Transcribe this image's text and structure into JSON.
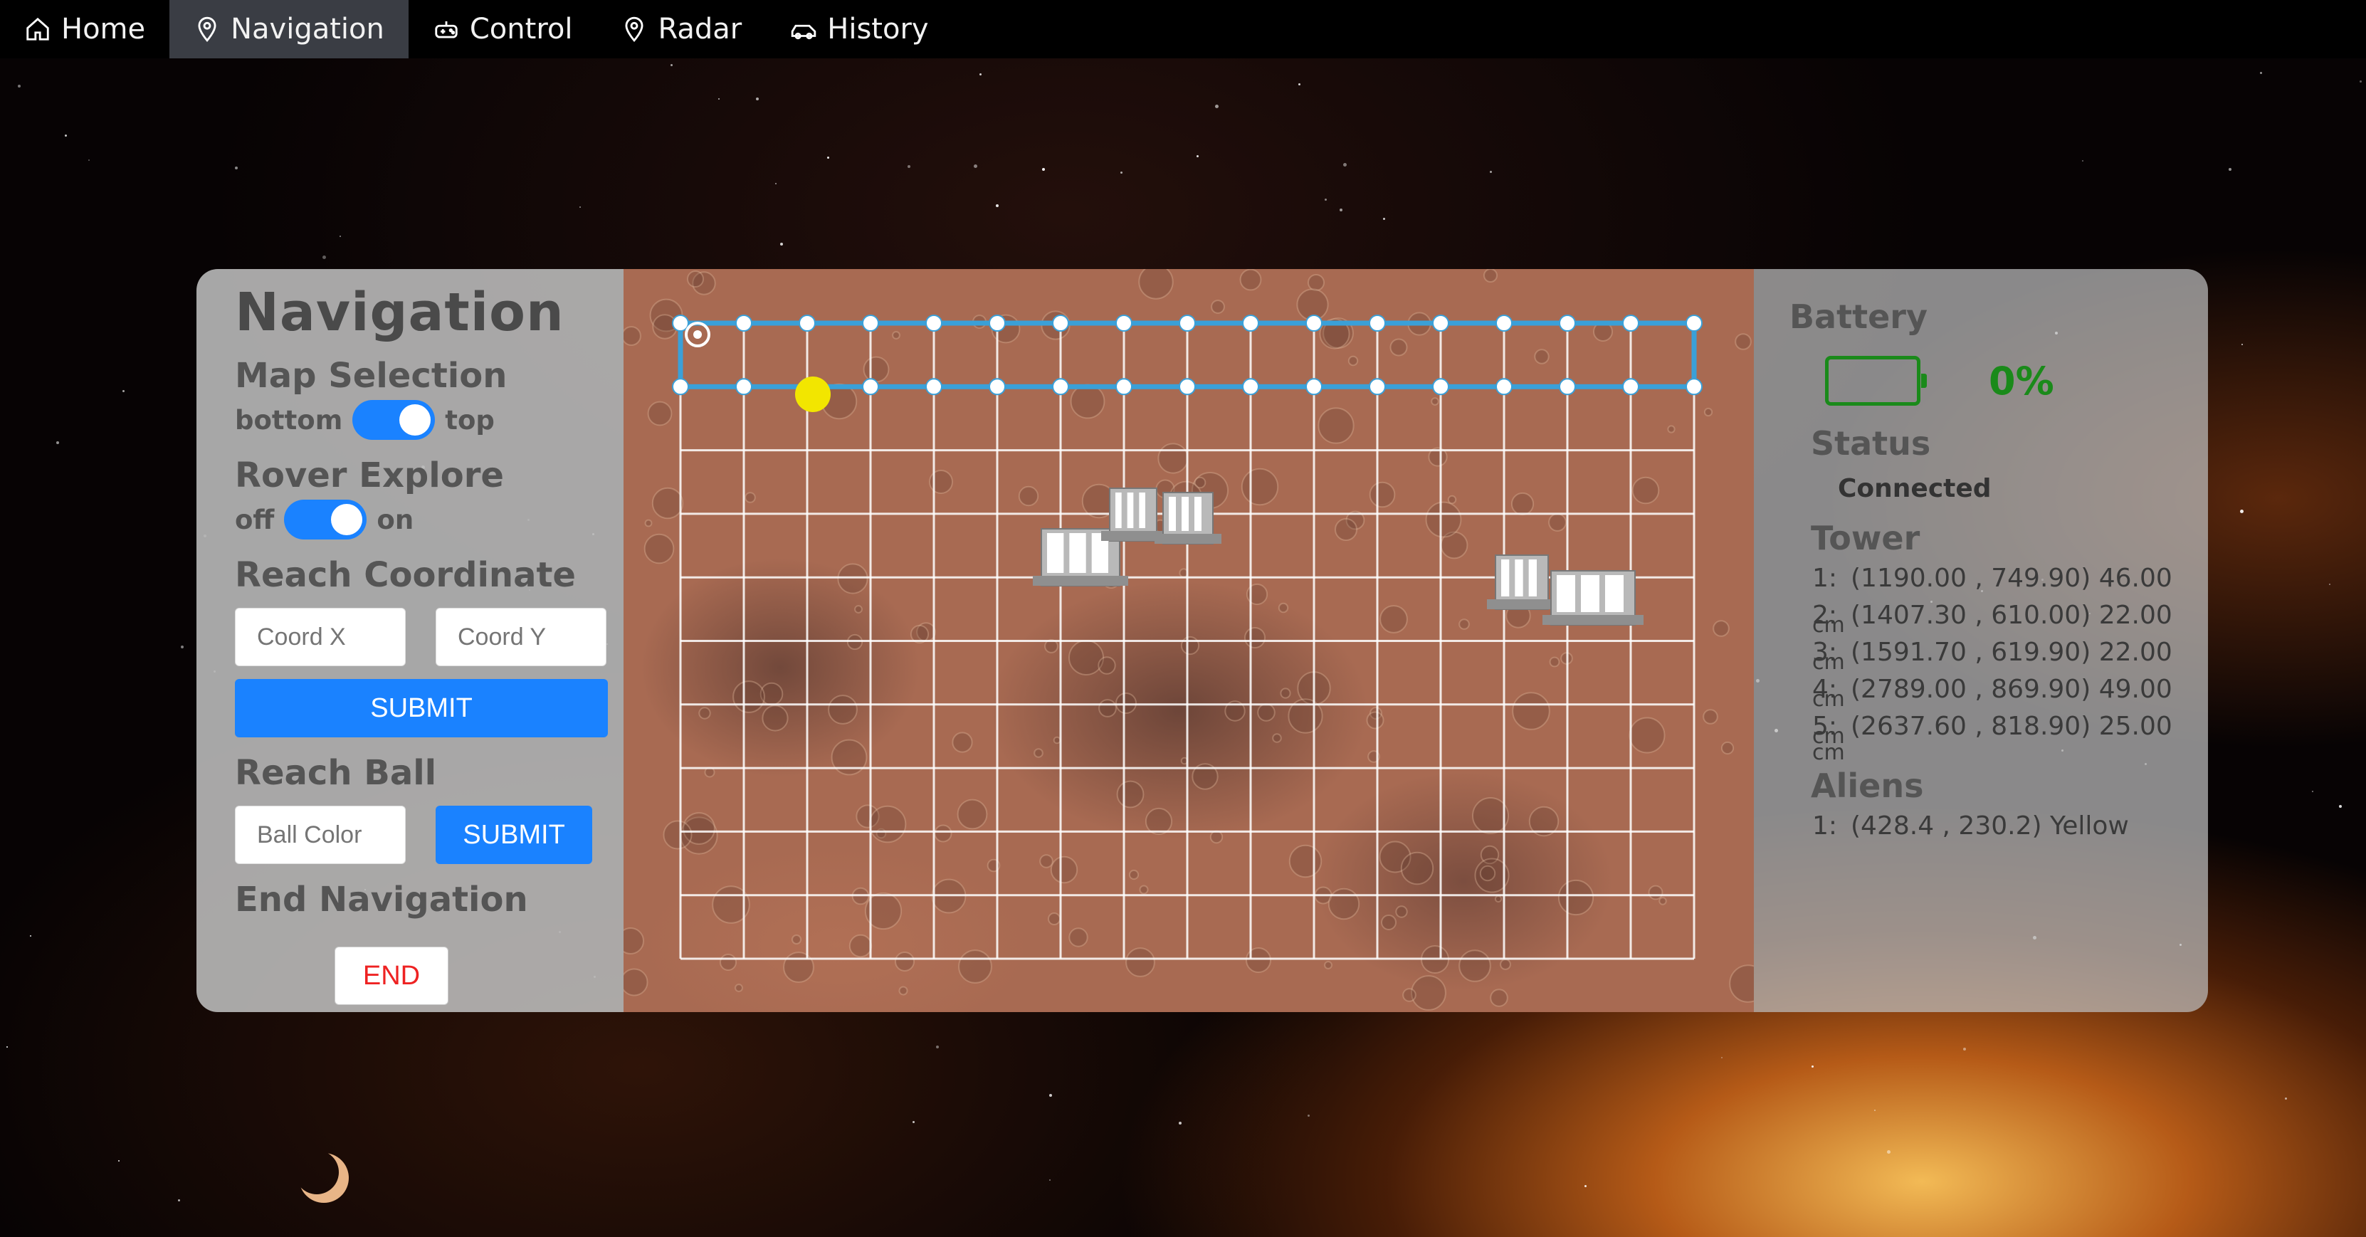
{
  "nav": {
    "items": [
      {
        "label": "Home",
        "icon": "home-icon"
      },
      {
        "label": "Navigation",
        "icon": "location-pin-icon"
      },
      {
        "label": "Control",
        "icon": "controller-icon"
      },
      {
        "label": "Radar",
        "icon": "location-pin-icon"
      },
      {
        "label": "History",
        "icon": "car-icon"
      }
    ],
    "active": "Navigation"
  },
  "left": {
    "title": "Navigation",
    "map_selection": {
      "title": "Map Selection",
      "off_label": "bottom",
      "on_label": "top",
      "state": "top"
    },
    "rover_explore": {
      "title": "Rover Explore",
      "off_label": "off",
      "on_label": "on",
      "state": "on"
    },
    "reach_coordinate": {
      "title": "Reach Coordinate",
      "x_placeholder": "Coord X",
      "y_placeholder": "Coord Y",
      "submit_label": "SUBMIT"
    },
    "reach_ball": {
      "title": "Reach Ball",
      "placeholder": "Ball Color",
      "submit_label": "SUBMIT"
    },
    "end_navigation": {
      "title": "End Navigation",
      "button_label": "END"
    }
  },
  "right": {
    "battery": {
      "title": "Battery",
      "percent": "0%"
    },
    "status": {
      "title": "Status",
      "value": "Connected"
    },
    "tower": {
      "title": "Tower",
      "entries": [
        {
          "index": "1:",
          "text": "(1190.00 ,  749.90) 46.00"
        },
        {
          "index": "2:",
          "text": "(1407.30 ,  610.00) 22.00"
        },
        {
          "index": "3:",
          "text": "(1591.70 ,  619.90) 22.00"
        },
        {
          "index": "4:",
          "text": "(2789.00 ,  869.90) 49.00"
        },
        {
          "index": "5:",
          "text": "(2637.60 ,  818.90) 25.00"
        }
      ],
      "unit_suffix": "cm"
    },
    "aliens": {
      "title": "Aliens",
      "entries": [
        {
          "index": "1:",
          "text": "(428.4 ,  230.2) Yellow"
        }
      ]
    }
  },
  "colors": {
    "accent": "#1a82ff",
    "battery_green": "#1a8a1a",
    "end_red": "#e22222",
    "path_blue": "#3aa0d8",
    "alien_yellow": "#f2e600"
  }
}
